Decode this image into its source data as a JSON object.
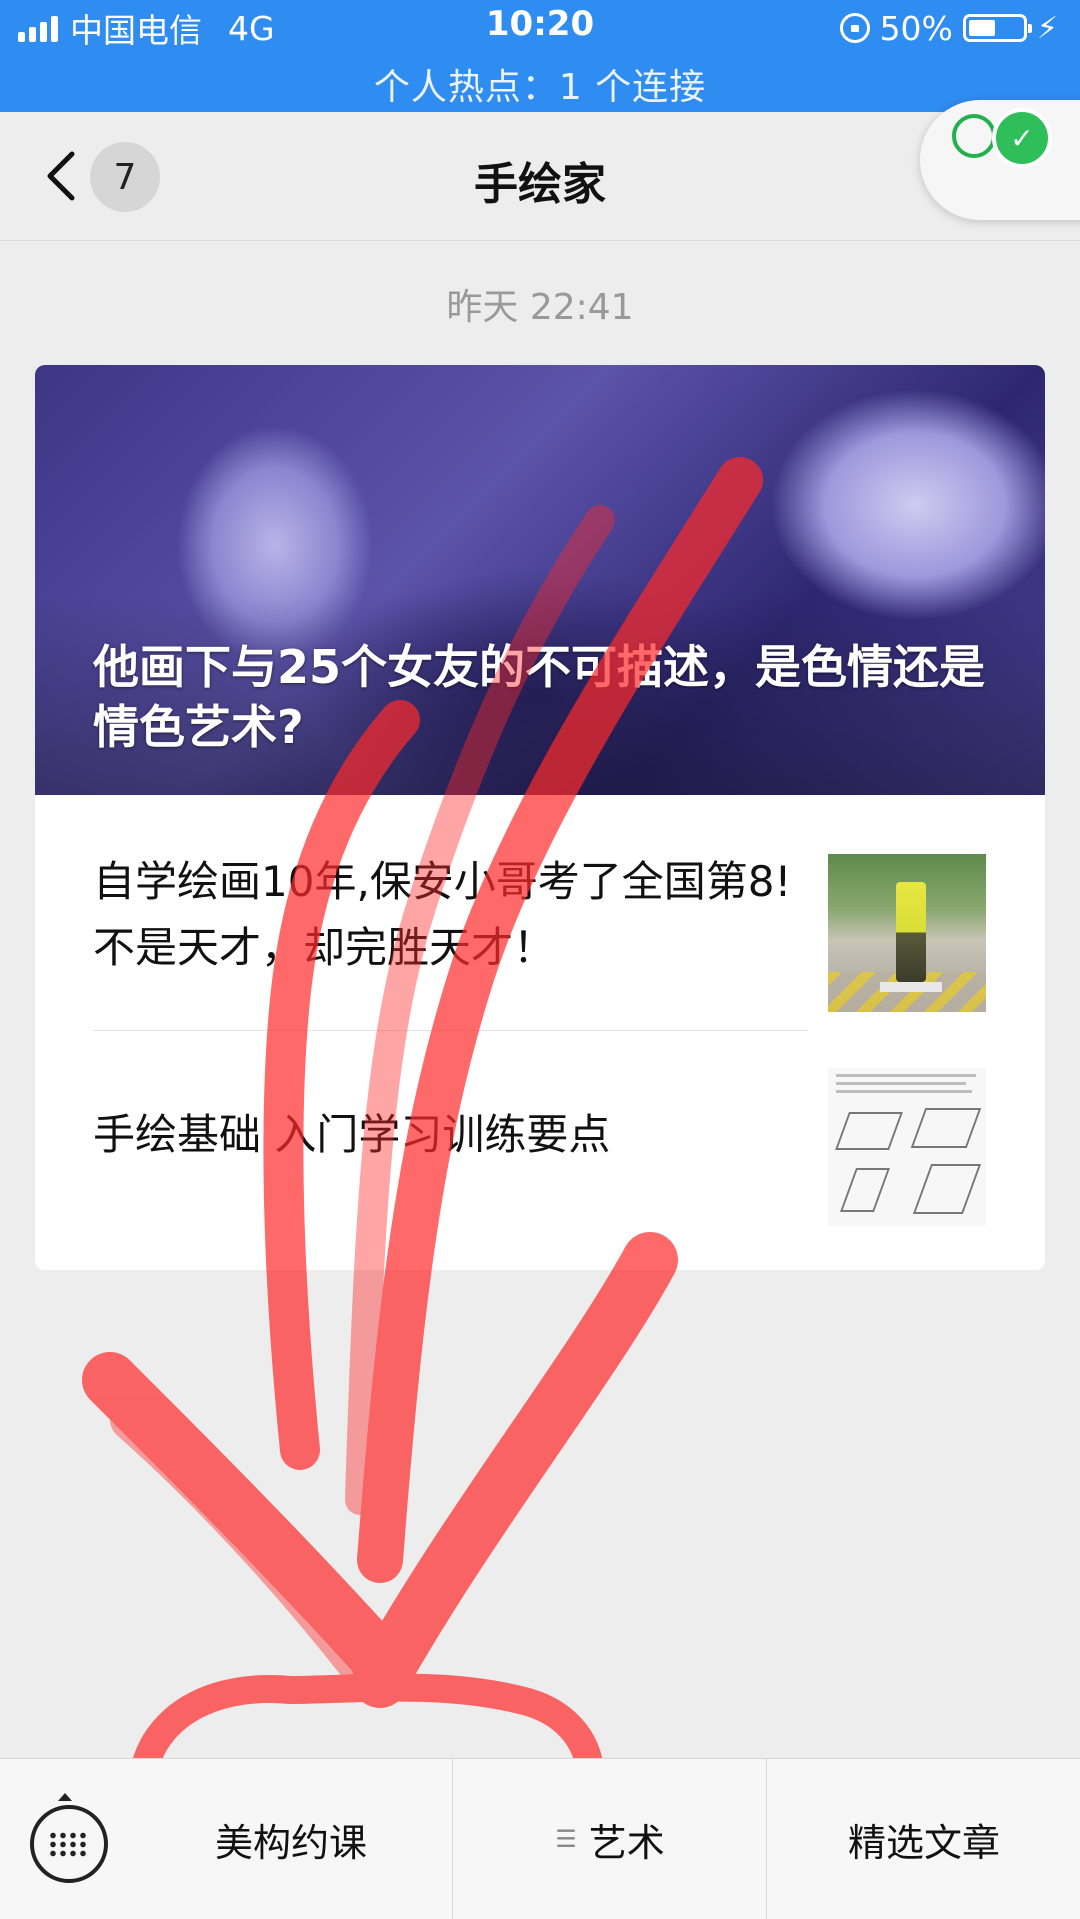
{
  "status_bar": {
    "carrier": "中国电信",
    "network": "4G",
    "time": "10:20",
    "battery": "50%",
    "battery_level": 0.5,
    "hotspot": "个人热点：1 个连接"
  },
  "nav": {
    "unread_count": "7",
    "title": "手绘家"
  },
  "message": {
    "timestamp": "昨天 22:41",
    "cover_title": "他画下与25个女友的不可描述，是色情还是情色艺术?",
    "articles": [
      {
        "title": "自学绘画10年,保安小哥考了全国第8!不是天才，却完胜天才！"
      },
      {
        "title": "手绘基础 入门学习训练要点"
      }
    ]
  },
  "bottom_menu": {
    "items": [
      {
        "label": "美构约课"
      },
      {
        "label": "艺术",
        "has_submenu": true
      },
      {
        "label": "精选文章"
      }
    ]
  },
  "colors": {
    "status_bar": "#2f8cf0",
    "annotation": "#ff2a2a",
    "wechat_green": "#2fbf5a"
  },
  "icons": [
    "back-arrow-icon",
    "wechat-icon",
    "edit-icon",
    "keyboard-icon",
    "submenu-icon",
    "signal-icon",
    "battery-icon"
  ]
}
